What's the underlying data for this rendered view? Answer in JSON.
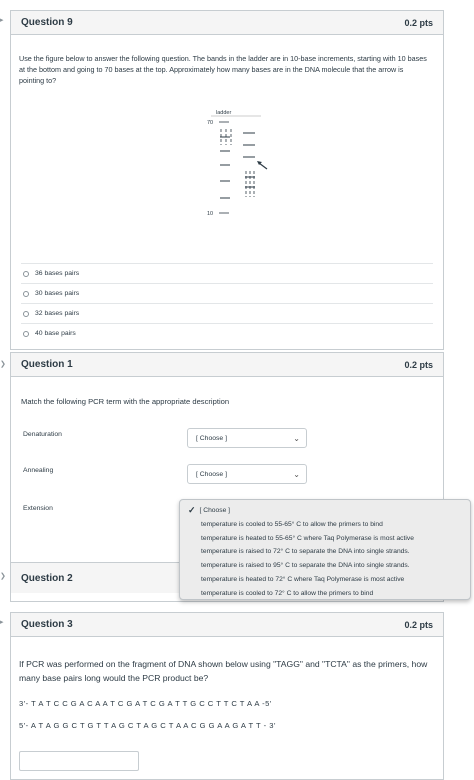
{
  "q9": {
    "title": "Question 9",
    "points": "0.2 pts",
    "prompt": "Use the figure below to answer the following question. The bands in the ladder are in 10-base increments, starting with 10 bases at the bottom and going to 70 bases at the top. Approximately how many bases are in the DNA molecule that the arrow is pointing to?",
    "figure": {
      "ladder_label": "ladder",
      "top_tick": "70",
      "bottom_tick": "10"
    },
    "answers": [
      "36 bases pairs",
      "30 bases pairs",
      "32 bases pairs",
      "40 base pairs"
    ]
  },
  "q1": {
    "title": "Question 1",
    "points": "0.2 pts",
    "prompt": "Match the following PCR term with the appropriate description",
    "terms": [
      {
        "label": "Denaturation",
        "select": "[ Choose ]"
      },
      {
        "label": "Annealing",
        "select": "[ Choose ]"
      },
      {
        "label": "Extension"
      }
    ],
    "dropdown": {
      "selected": "[ Choose ]",
      "options": [
        "temperature is cooled to 55-65° C to allow the primers to bind",
        "temperature is heated to 55-65° C where Taq Polymerase is most active",
        "temperature is raised to 72° C to separate the DNA into single strands.",
        "temperature is raised to 95° C to separate the DNA into single strands.",
        "temperature is heated to 72° C where Taq Polymerase is most active",
        "temperature is cooled to 72° C to allow the primers to bind"
      ]
    }
  },
  "q2": {
    "title": "Question 2"
  },
  "q3": {
    "title": "Question 3",
    "points": "0.2 pts",
    "prompt": "If PCR was performed on the fragment of DNA shown below using \"TAGG\" and \"TCTA\" as the primers, how many base pairs long would the PCR product be?",
    "seq_top": "3'- T A T C C G A C A A T C G A T C G A T T G C C T T C T A A -5'",
    "seq_bottom": "5'- A T A G G C T G T T A G C T A G C T A A C G G A A G A T T - 3'",
    "answer_value": ""
  }
}
